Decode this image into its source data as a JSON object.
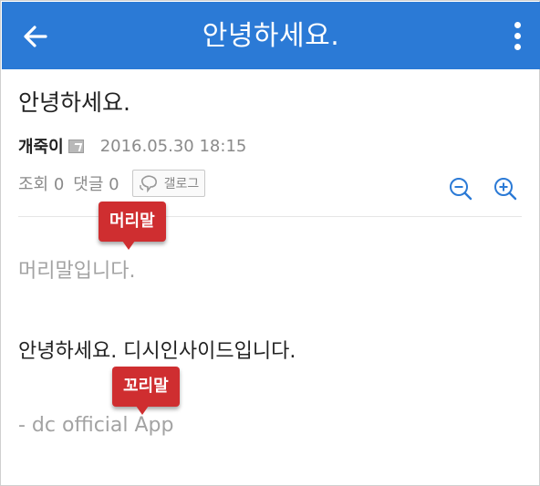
{
  "appbar": {
    "title": "안녕하세요.",
    "background": "#2b7ad6",
    "back_icon": "arrow-left-icon",
    "more_icon": "more-vertical-icon"
  },
  "post": {
    "title": "안녕하세요.",
    "author": "개죽이",
    "author_badge_icon": "fixed-nick-badge-icon",
    "date": "2016.05.30 18:15",
    "views_label": "조회 0",
    "comments_label": "댓글 0",
    "gallog_label": "갤로그",
    "header_text": "머리말입니다.",
    "body_text": "안녕하세요. 디시인사이드입니다.",
    "footer_text": "- dc official App"
  },
  "tags": {
    "header_tag": "머리말",
    "footer_tag": "꼬리말",
    "color": "#cf2e30"
  },
  "zoom": {
    "out_icon": "zoom-out-icon",
    "in_icon": "zoom-in-icon",
    "color": "#2b7ad6"
  }
}
